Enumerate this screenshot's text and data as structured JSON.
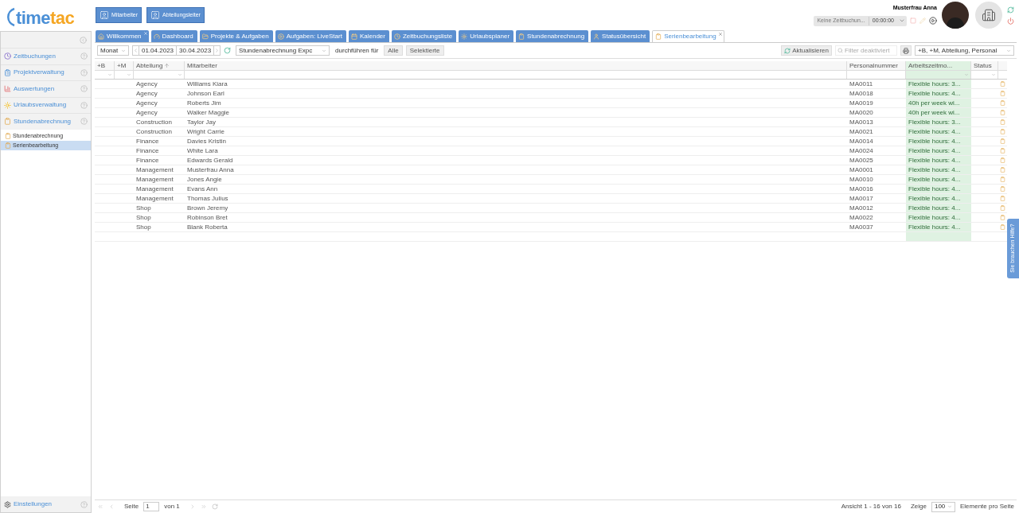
{
  "header": {
    "logo": [
      "time",
      "tac"
    ],
    "role_buttons": [
      "Mitarbeiter",
      "Abteilungsleiter"
    ],
    "user_name": "Musterfrau Anna",
    "time_tracker": {
      "activity": "Keine Zeitbuchun...",
      "timer": "00:00:00"
    }
  },
  "sidebar": {
    "sections": [
      {
        "label": "Zeitbuchungen"
      },
      {
        "label": "Projektverwaltung"
      },
      {
        "label": "Auswertungen"
      },
      {
        "label": "Urlaubsverwaltung"
      },
      {
        "label": "Stundenabrechnung",
        "children": [
          {
            "label": "Stundenabrechnung",
            "selected": false
          },
          {
            "label": "Serienbearbeitung",
            "selected": true
          }
        ]
      }
    ],
    "footer": "Einstellungen"
  },
  "tabs": [
    {
      "label": "Willkommen",
      "selected": false,
      "closable": true
    },
    {
      "label": "Dashboard",
      "selected": false,
      "closable": false
    },
    {
      "label": "Projekte & Aufgaben",
      "selected": false,
      "closable": false
    },
    {
      "label": "Aufgaben: LiveStart",
      "selected": false,
      "closable": false
    },
    {
      "label": "Kalender",
      "selected": false,
      "closable": false
    },
    {
      "label": "Zeitbuchungsliste",
      "selected": false,
      "closable": false
    },
    {
      "label": "Urlaubsplaner",
      "selected": false,
      "closable": false
    },
    {
      "label": "Stundenabrechnung",
      "selected": false,
      "closable": false
    },
    {
      "label": "Statusübersicht",
      "selected": false,
      "closable": false
    },
    {
      "label": "Serienbearbeitung",
      "selected": true,
      "closable": true
    }
  ],
  "toolbar": {
    "period": "Monat",
    "date_from": "01.04.2023",
    "date_to": "30.04.2023",
    "action": "Stundenabrechnung Expc",
    "apply_label": "durchführen für",
    "apply_buttons": [
      "Alle",
      "Selektierte"
    ],
    "refresh": "Aktualisieren",
    "filter_placeholder": "Filter deaktiviert",
    "columns_select": "+B, +M, Abteilung, Personal"
  },
  "table": {
    "columns": [
      {
        "label": "+B",
        "sorted": false,
        "filter_dropdown": true,
        "highlighted": false
      },
      {
        "label": "+M",
        "sorted": false,
        "filter_dropdown": true,
        "highlighted": false
      },
      {
        "label": "Abteilung",
        "sorted": true,
        "filter_dropdown": true,
        "highlighted": false
      },
      {
        "label": "Mitarbeiter",
        "sorted": false,
        "filter_dropdown": false,
        "highlighted": false
      },
      {
        "label": "Personalnummer",
        "sorted": false,
        "filter_dropdown": false,
        "highlighted": false
      },
      {
        "label": "Arbeitszeitmo...",
        "sorted": false,
        "filter_dropdown": true,
        "highlighted": true
      },
      {
        "label": "Status",
        "sorted": false,
        "filter_dropdown": true,
        "highlighted": false
      }
    ],
    "rows": [
      {
        "department": "Agency",
        "employee": "Williams Kiara",
        "number": "MA0011",
        "model": "Flexible hours: 3..."
      },
      {
        "department": "Agency",
        "employee": "Johnson Earl",
        "number": "MA0018",
        "model": "Flexible hours: 4..."
      },
      {
        "department": "Agency",
        "employee": "Roberts Jim",
        "number": "MA0019",
        "model": "40h per week wi..."
      },
      {
        "department": "Agency",
        "employee": "Walker Maggie",
        "number": "MA0020",
        "model": "40h per week wi..."
      },
      {
        "department": "Construction",
        "employee": "Taylor Jay",
        "number": "MA0013",
        "model": "Flexible hours: 3..."
      },
      {
        "department": "Construction",
        "employee": "Wright Carrie",
        "number": "MA0021",
        "model": "Flexible hours: 4..."
      },
      {
        "department": "Finance",
        "employee": "Davies Kristin",
        "number": "MA0014",
        "model": "Flexible hours: 4..."
      },
      {
        "department": "Finance",
        "employee": "White Lara",
        "number": "MA0024",
        "model": "Flexible hours: 4..."
      },
      {
        "department": "Finance",
        "employee": "Edwards Gerald",
        "number": "MA0025",
        "model": "Flexible hours: 4..."
      },
      {
        "department": "Management",
        "employee": "Musterfrau Anna",
        "number": "MA0001",
        "model": "Flexible hours: 4..."
      },
      {
        "department": "Management",
        "employee": "Jones Angie",
        "number": "MA0010",
        "model": "Flexible hours: 4..."
      },
      {
        "department": "Management",
        "employee": "Evans Ann",
        "number": "MA0016",
        "model": "Flexible hours: 4..."
      },
      {
        "department": "Management",
        "employee": "Thomas Julius",
        "number": "MA0017",
        "model": "Flexible hours: 4..."
      },
      {
        "department": "Shop",
        "employee": "Brown Jeremy",
        "number": "MA0012",
        "model": "Flexible hours: 4..."
      },
      {
        "department": "Shop",
        "employee": "Robinson Bret",
        "number": "MA0022",
        "model": "Flexible hours: 4..."
      },
      {
        "department": "Shop",
        "employee": "Blank Roberta",
        "number": "MA0037",
        "model": "Flexible hours: 4..."
      }
    ]
  },
  "pager": {
    "page_label": "Seite",
    "page": "1",
    "of_label": "von 1",
    "summary": "Ansicht 1 - 16 von 16",
    "show_label": "Zeige",
    "page_size": "100",
    "per_page_label": "Elemente pro Seite"
  },
  "help_tab": "Sie brauchen Hilfe?"
}
